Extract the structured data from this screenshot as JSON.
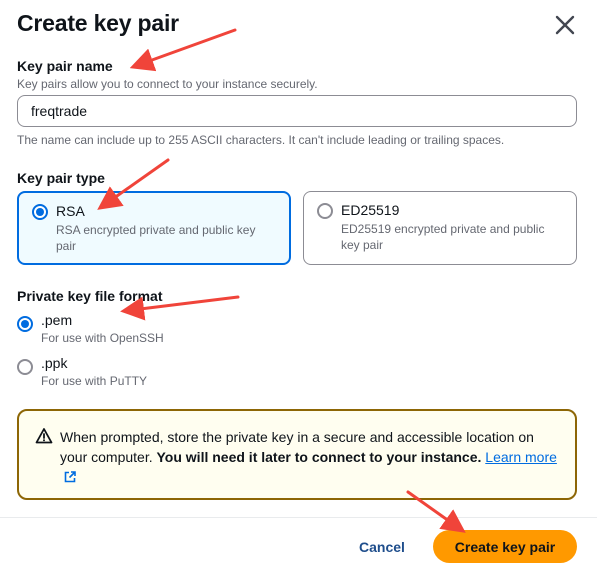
{
  "modal": {
    "title": "Create key pair"
  },
  "key_name": {
    "label": "Key pair name",
    "description": "Key pairs allow you to connect to your instance securely.",
    "value": "freqtrade",
    "constraint": "The name can include up to 255 ASCII characters. It can't include leading or trailing spaces."
  },
  "key_type": {
    "label": "Key pair type",
    "options": [
      {
        "title": "RSA",
        "description": "RSA encrypted private and public key pair",
        "selected": true
      },
      {
        "title": "ED25519",
        "description": "ED25519 encrypted private and public key pair",
        "selected": false
      }
    ]
  },
  "file_format": {
    "label": "Private key file format",
    "options": [
      {
        "title": ".pem",
        "description": "For use with OpenSSH",
        "selected": true
      },
      {
        "title": ".ppk",
        "description": "For use with PuTTY",
        "selected": false
      }
    ]
  },
  "alert": {
    "text": "When prompted, store the private key in a secure and accessible location on your computer.",
    "bold_text": "You will need it later to connect to your instance.",
    "link_text": "Learn more",
    "icon": "warning-icon"
  },
  "footer": {
    "cancel_label": "Cancel",
    "primary_label": "Create key pair"
  },
  "colors": {
    "accent": "#006ce0",
    "primary_button": "#ff9900",
    "alert_border": "#8d6605",
    "annotation_arrow": "#f0443a"
  }
}
